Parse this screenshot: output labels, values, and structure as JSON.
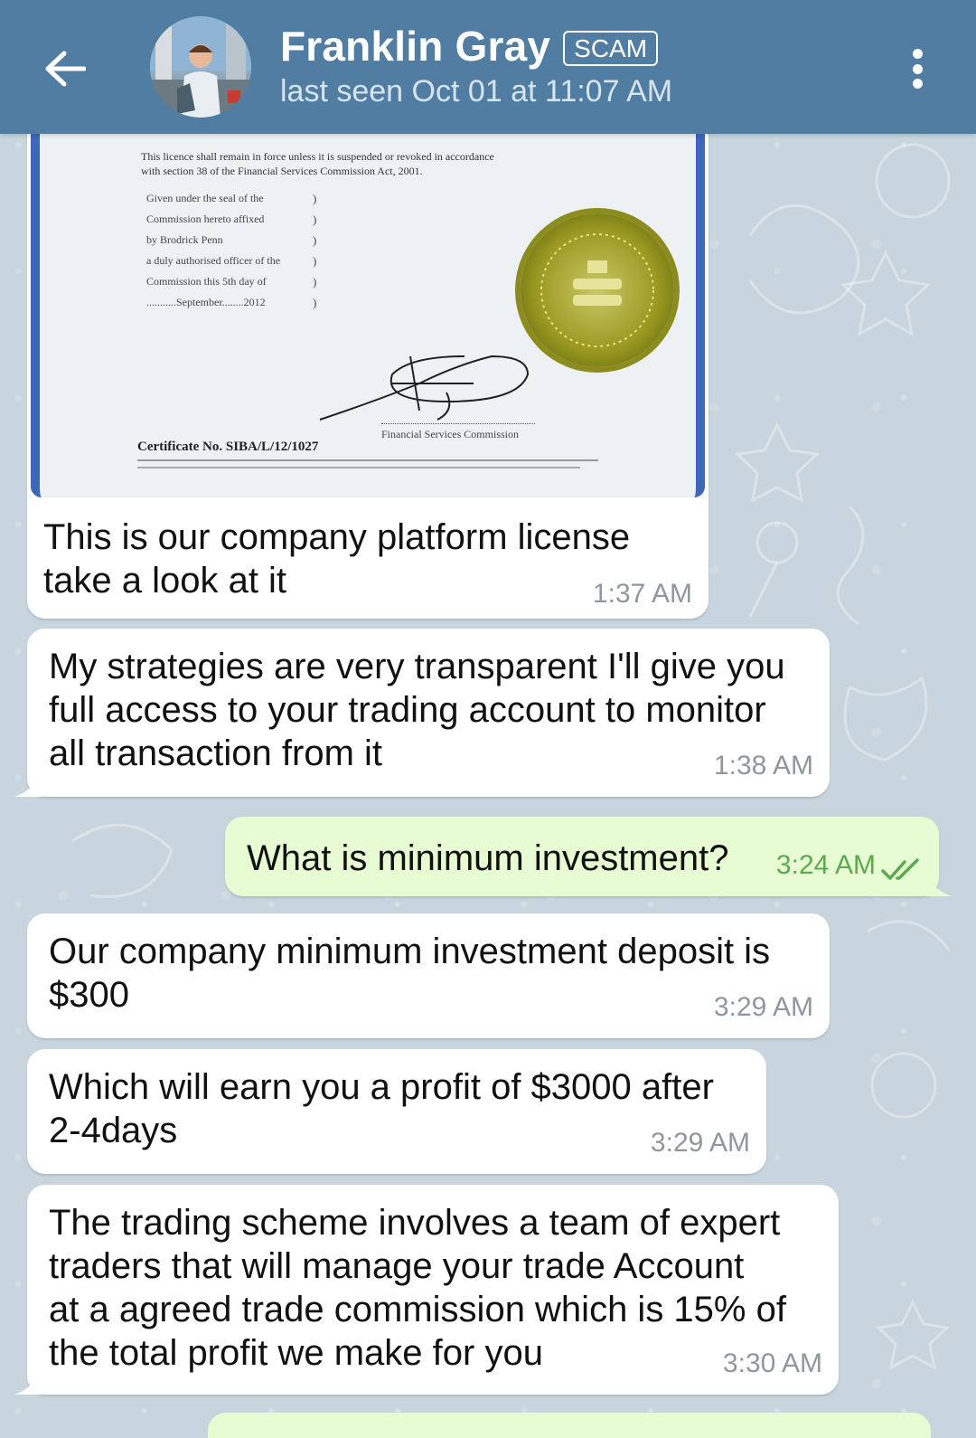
{
  "header": {
    "contact_name": "Franklin Gray",
    "badge": "SCAM",
    "last_seen": "last seen Oct 01 at 11:07 AM"
  },
  "license_doc": {
    "line1": "This licence shall remain in force unless it is suspended or revoked in accordance",
    "line2": "with section 38 of the Financial Services Commission Act, 2001.",
    "seal_lines": [
      "Given under the seal of the",
      "Commission hereto affixed",
      "by Brodrick Penn",
      "a duly authorised officer of the",
      "Commission this  5th  day of",
      "...........September........2012"
    ],
    "signature_caption": "Financial Services Commission",
    "certificate_no": "Certificate No. SIBA/L/12/1027"
  },
  "messages": [
    {
      "id": "m1",
      "direction": "in",
      "text": "This is our company platform license\ntake a look at it",
      "time": "1:37 AM"
    },
    {
      "id": "m2",
      "direction": "in",
      "text": "My strategies are very transparent I'll give you\nfull access to your trading account to monitor\nall transaction from it",
      "time": "1:38 AM"
    },
    {
      "id": "m3",
      "direction": "out",
      "text": "What is minimum investment?",
      "time": "3:24 AM",
      "read": true
    },
    {
      "id": "m4",
      "direction": "in",
      "text": "Our company minimum investment deposit is\n$300",
      "time": "3:29 AM"
    },
    {
      "id": "m5",
      "direction": "in",
      "text": "Which will earn you a profit of $3000 after\n2-4days",
      "time": "3:29 AM"
    },
    {
      "id": "m6",
      "direction": "in",
      "text": "The trading scheme involves a team of expert\ntraders that will manage your trade Account\nat a agreed trade commission which is 15% of\nthe total profit we make for you",
      "time": "3:30 AM"
    }
  ],
  "icons": {
    "back": "arrow-left-icon",
    "menu": "more-vertical-icon",
    "read_receipt": "double-check-icon"
  },
  "colors": {
    "header": "#517da2",
    "incoming_bubble": "#ffffff",
    "outgoing_bubble": "#e8fcd4",
    "outgoing_time": "#5ea84f",
    "chat_background": "#c8d5de"
  }
}
